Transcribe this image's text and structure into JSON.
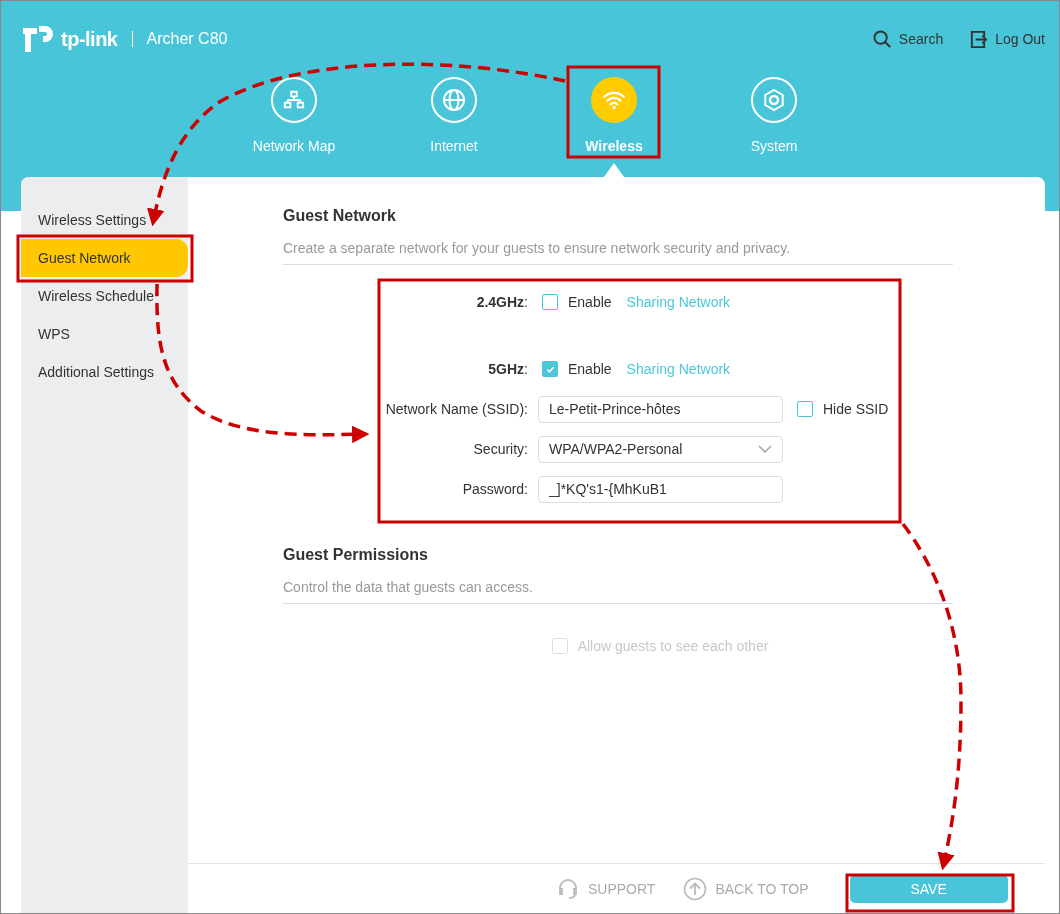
{
  "header": {
    "logo": "tp-link",
    "model": "Archer C80",
    "actions": [
      {
        "kind": "search",
        "label": "Search"
      },
      {
        "kind": "logout",
        "label": "Log Out"
      }
    ]
  },
  "nav": [
    {
      "kind": "map",
      "label": "Network Map",
      "selected": false
    },
    {
      "kind": "globe",
      "label": "Internet",
      "selected": false
    },
    {
      "kind": "wifi",
      "label": "Wireless",
      "selected": true
    },
    {
      "kind": "gear",
      "label": "System",
      "selected": false
    }
  ],
  "sidebar": {
    "items": [
      {
        "label": "Wireless Settings",
        "selected": false
      },
      {
        "label": "Guest Network",
        "selected": true
      },
      {
        "label": "Wireless Schedule",
        "selected": false
      },
      {
        "label": "WPS",
        "selected": false
      },
      {
        "label": "Additional Settings",
        "selected": false
      }
    ]
  },
  "guest_network": {
    "title": "Guest Network",
    "description": "Create a separate network for your guests to ensure network security and privacy.",
    "bands": [
      {
        "label": "**2.4GHz**:",
        "enable_label": "Enable",
        "checked": false,
        "link": "Sharing Network"
      },
      {
        "label": "**5GHz**:",
        "enable_label": "Enable",
        "checked": true,
        "link": "Sharing Network"
      }
    ],
    "fields": [
      {
        "kind": "text",
        "label": "Network Name (SSID):",
        "value": "Le-Petit-Prince-hôtes",
        "option": {
          "label": "Hide SSID",
          "checked": false
        }
      },
      {
        "kind": "select",
        "label": "Security:",
        "value": "WPA/WPA2-Personal"
      },
      {
        "kind": "text",
        "label": "Password:",
        "value": "_]*KQ's1-{MhKuB1"
      }
    ]
  },
  "guest_permissions": {
    "title": "Guest Permissions",
    "description": "Control the data that guests can access.",
    "option": {
      "label": "Allow guests to see each other",
      "checked": false,
      "disabled": true
    }
  },
  "footer": {
    "support": "SUPPORT",
    "back_to_top": "BACK TO TOP",
    "save": "SAVE"
  }
}
